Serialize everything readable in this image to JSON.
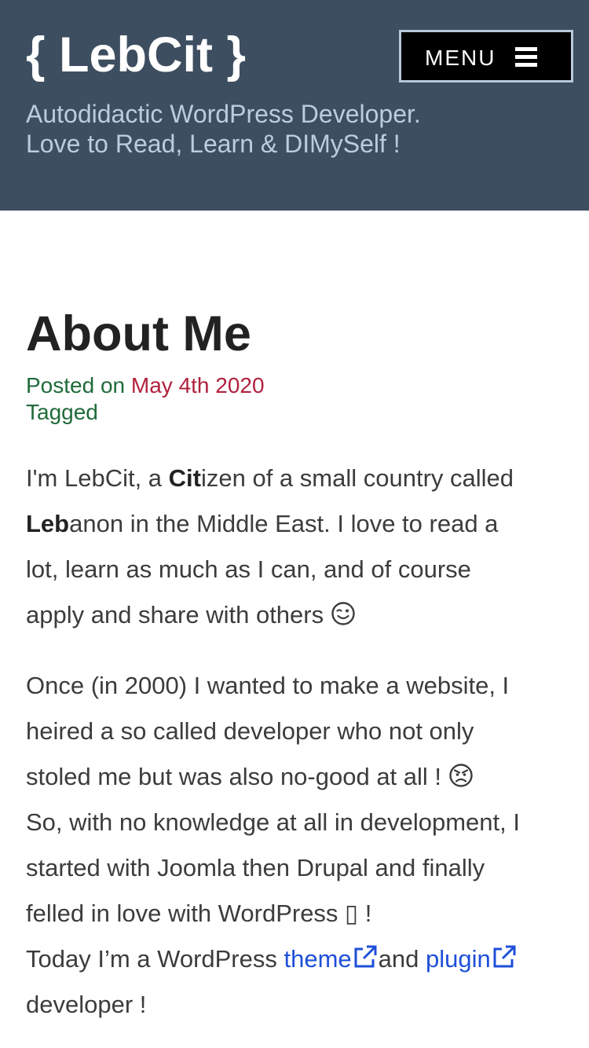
{
  "header": {
    "site_title": "{ LebCit }",
    "menu_label": "MENU",
    "tagline_line1": "Autodidactic WordPress Developer.",
    "tagline_line2": "Love to Read, Learn & DIMySelf !"
  },
  "post": {
    "title": "About Me",
    "posted_on_label": "Posted on",
    "date": "May 4th 2020",
    "tagged_label": "Tagged"
  },
  "content": {
    "p1_l1_a": "I'm LebCit, a ",
    "p1_l1_b": "Cit",
    "p1_l1_c": "izen of a small country called",
    "p1_l2_a": "Leb",
    "p1_l2_b": "anon in the Middle East. I love to read a",
    "p1_l3": "lot, learn as much as I can, and of course",
    "p1_l4": "apply and share with others ",
    "p2_l1": "Once (in 2000) I wanted to make a website, I",
    "p2_l2": "heired a so called developer who not only",
    "p2_l3": "stoled me but was also no-good at all ! ",
    "p2_l4": "So, with no knowledge at all in development, I",
    "p2_l5": "started with Joomla then Drupal and finally",
    "p2_l6_a": "felled in love with WordPress ",
    "p2_l6_glyph": "▯",
    "p2_l6_b": " !",
    "p2_l7_a": "Today I’m a WordPress ",
    "theme_link": "theme",
    "p2_l7_b": "and ",
    "plugin_link": "plugin",
    "p2_l8": "developer !"
  },
  "icons": {
    "menu": "hamburger-icon",
    "wink": "wink-emoji",
    "angry": "angry-emoji",
    "external": "external-link-icon"
  },
  "colors": {
    "header_bg": "#3d4e60",
    "tagline": "#b9cde0",
    "meta_green": "#1f6b3a",
    "date_red": "#b0213d",
    "link_blue": "#1e4fd8"
  }
}
